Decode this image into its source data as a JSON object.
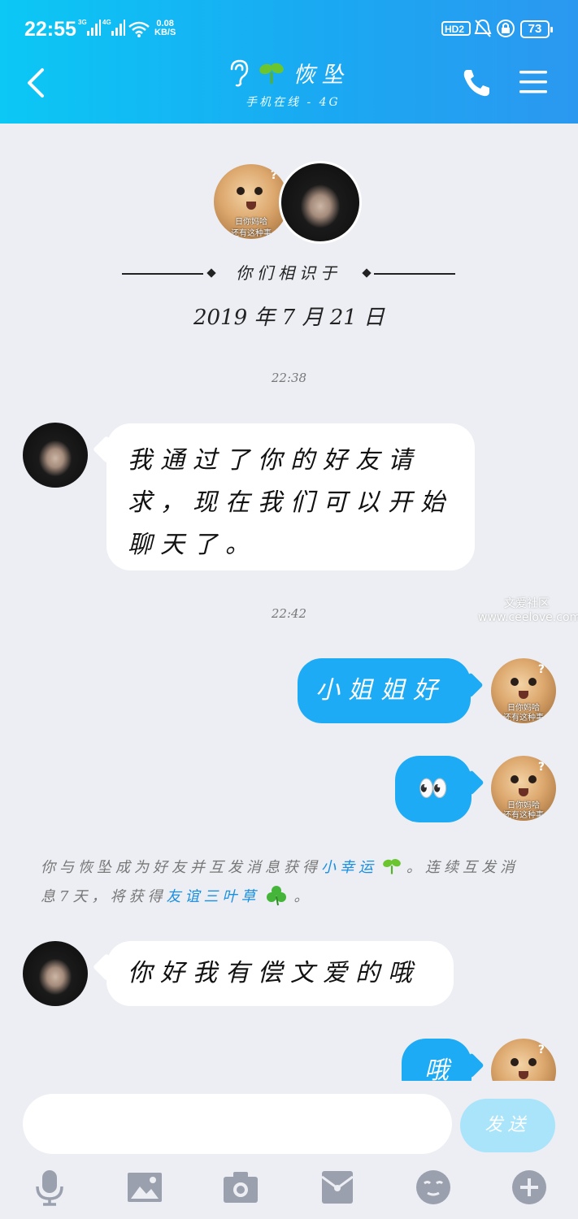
{
  "status_bar": {
    "time": "22:55",
    "net_speed_value": "0.08",
    "net_speed_unit": "KB/S",
    "signal1_label": "3G",
    "signal2_label": "4G",
    "hd_label": "HD2",
    "battery": "73"
  },
  "header": {
    "title": "恢坠",
    "subtitle": "手机在线 - 4G",
    "back_icon": "chevron-left-icon",
    "call_icon": "phone-icon",
    "menu_icon": "menu-icon"
  },
  "intro": {
    "met_text": "你们相识于",
    "date": "2019 年 7 月 21 日"
  },
  "avatar_caption": [
    "日你妈哈",
    "还有这种事"
  ],
  "messages": [
    {
      "time": "22:38"
    },
    {
      "side": "left",
      "text": "我通过了你的好友请求，现在我们可以开始聊天了。"
    },
    {
      "time": "22:42"
    },
    {
      "side": "right",
      "text": "小姐姐好"
    },
    {
      "side": "right",
      "text": "👀"
    },
    {
      "side": "left",
      "text": "你好我有偿文爱的哦"
    },
    {
      "side": "right",
      "text": "哦"
    }
  ],
  "system_message": {
    "part1": "你与恢坠成为好友并互发消息获得",
    "link1": "小幸运",
    "part2": "。连续互发消息7天，将获得",
    "link2": "友谊三叶草",
    "part3": "。"
  },
  "watermark": {
    "line1": "文爱社区",
    "line2": "www.ceelove.com"
  },
  "input_bar": {
    "placeholder": "",
    "send_label": "发送",
    "tools": [
      "microphone-icon",
      "image-icon",
      "camera-icon",
      "red-packet-icon",
      "emoji-icon",
      "plus-icon"
    ]
  },
  "colors": {
    "header_gradient_start": "#0bc8f5",
    "header_gradient_end": "#2b98f0",
    "bubble_self": "#1cabf4",
    "bubble_other": "#ffffff",
    "background": "#eceef3",
    "link": "#1a8fe0"
  }
}
